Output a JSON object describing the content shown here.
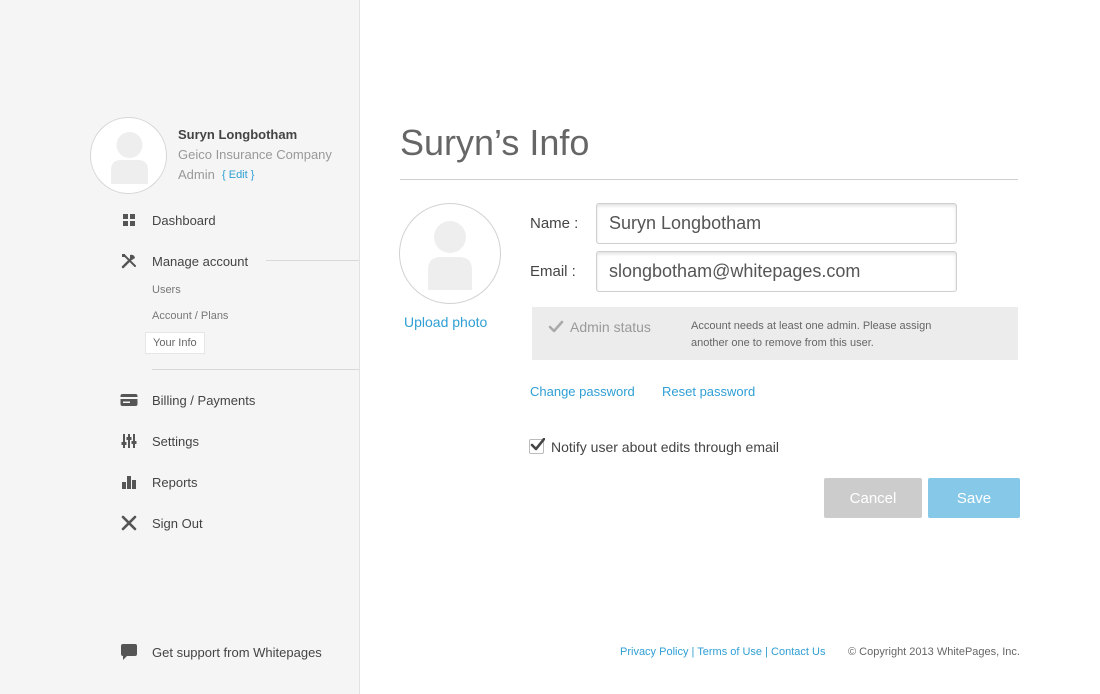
{
  "sidebar": {
    "profile": {
      "name": "Suryn Longbotham",
      "company": "Geico Insurance Company",
      "role": "Admin",
      "edit_label": "{ Edit }"
    },
    "nav": {
      "dashboard": "Dashboard",
      "manage_account": "Manage account",
      "billing": "Billing / Payments",
      "settings": "Settings",
      "reports": "Reports",
      "sign_out": "Sign Out"
    },
    "sub_items": {
      "users": "Users",
      "account_plans": "Account / Plans",
      "your_info": "Your Info"
    },
    "support": "Get support from Whitepages"
  },
  "main": {
    "title": "Suryn’s Info",
    "upload_photo": "Upload photo",
    "name_label": "Name :",
    "name_value": "Suryn Longbotham",
    "email_label": "Email :",
    "email_value": "slongbotham@whitepages.com",
    "admin_status_label": "Admin status",
    "admin_status_checked": true,
    "admin_note": "Account needs at least one admin. Please assign another one to remove from this user.",
    "change_password": "Change password",
    "reset_password": "Reset password",
    "notify_label": "Notify user about edits through email",
    "notify_checked": true,
    "cancel_label": "Cancel",
    "save_label": "Save"
  },
  "footer": {
    "privacy": "Privacy Policy",
    "terms": "Terms of Use",
    "contact": "Contact Us",
    "separator": "|",
    "copyright": "© Copyright 2013 WhitePages, Inc."
  },
  "colors": {
    "accent": "#2f9fd4",
    "save_button": "#86c8e8",
    "cancel_button": "#cccccc",
    "sidebar_bg": "#f5f5f5"
  }
}
